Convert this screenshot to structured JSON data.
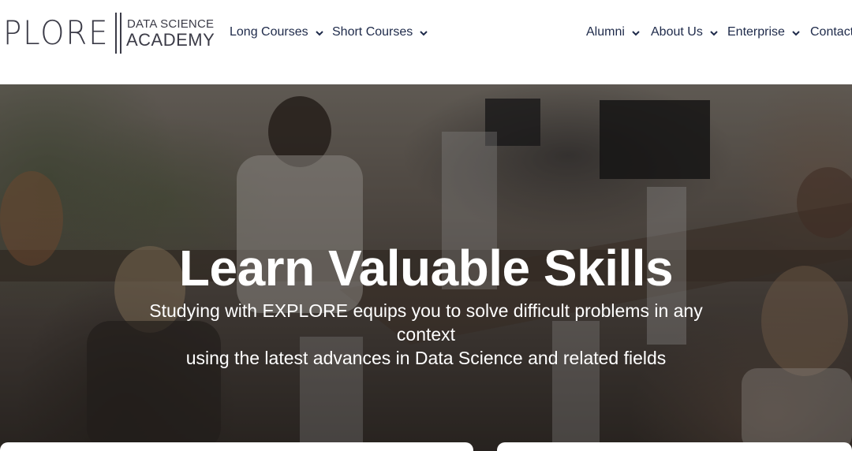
{
  "logo": {
    "wordmark": "PLORE",
    "line1": "DATA SCIENCE",
    "line2": "ACADEMY"
  },
  "nav": {
    "items": [
      {
        "label": "Long Courses",
        "icon": "chevron-down-icon"
      },
      {
        "label": "Short Courses",
        "icon": "chevron-down-icon"
      },
      {
        "label": "Alumni",
        "icon": "chevron-down-icon"
      },
      {
        "label": "About Us",
        "icon": "chevron-down-icon"
      },
      {
        "label": "Enterprise",
        "icon": "chevron-down-icon"
      },
      {
        "label": "Contact"
      }
    ]
  },
  "hero": {
    "title": "Learn Valuable Skills",
    "subtitle_line1": "Studying with EXPLORE equips you to solve difficult problems in any context",
    "subtitle_line2": "using the latest advances in Data Science and related fields"
  },
  "colors": {
    "nav_text": "#1e2a4a",
    "logo": "#3b3b47",
    "hero_text": "#ffffff"
  }
}
